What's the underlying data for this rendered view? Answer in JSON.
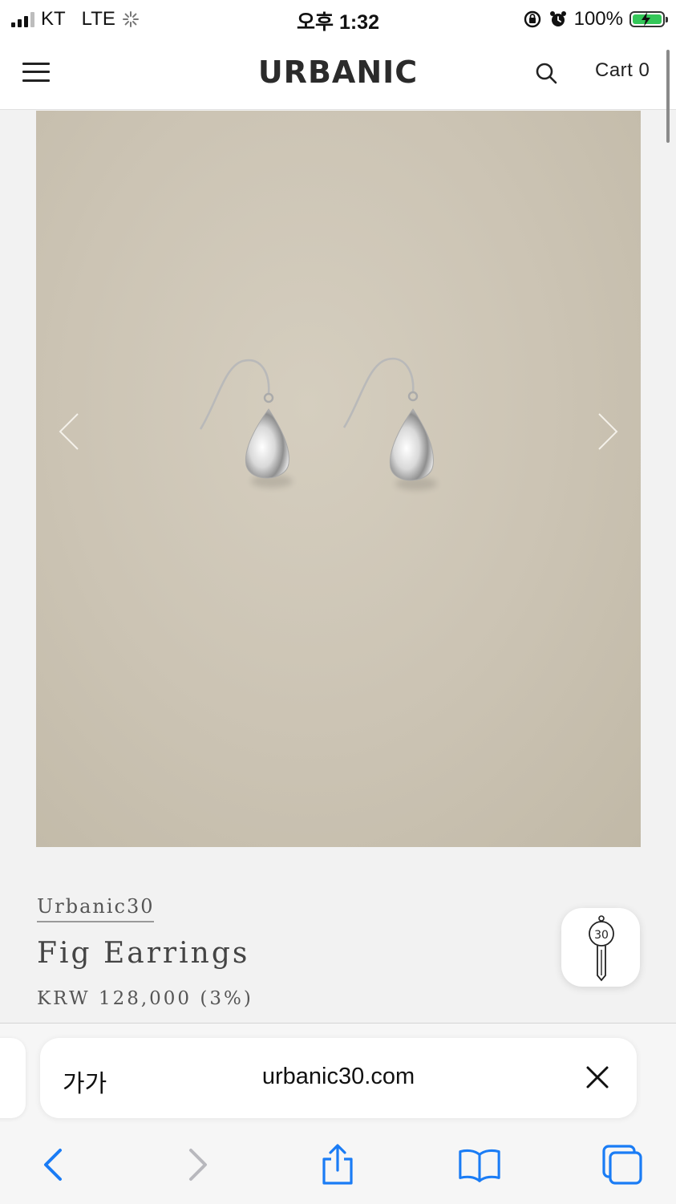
{
  "status_bar": {
    "carrier": "KT",
    "network": "LTE",
    "time": "오후 1:32",
    "battery": "100%",
    "battery_level": 1.0,
    "battery_color": "#34c759"
  },
  "header": {
    "logo": "URBANIC",
    "cart_label": "Cart 0"
  },
  "product": {
    "image_alt_icon": "earrings-photo",
    "brand": "Urbanic30",
    "name": "Fig Earrings",
    "price": "KRW 128,000 (3%)"
  },
  "floating_button": {
    "icon": "urbanic30-key-icon",
    "label": "30"
  },
  "browser": {
    "text_size_label": "가가",
    "url": "urbanic30.com",
    "accent_color": "#1a7cf5",
    "disabled_color": "#b8b8bd"
  }
}
